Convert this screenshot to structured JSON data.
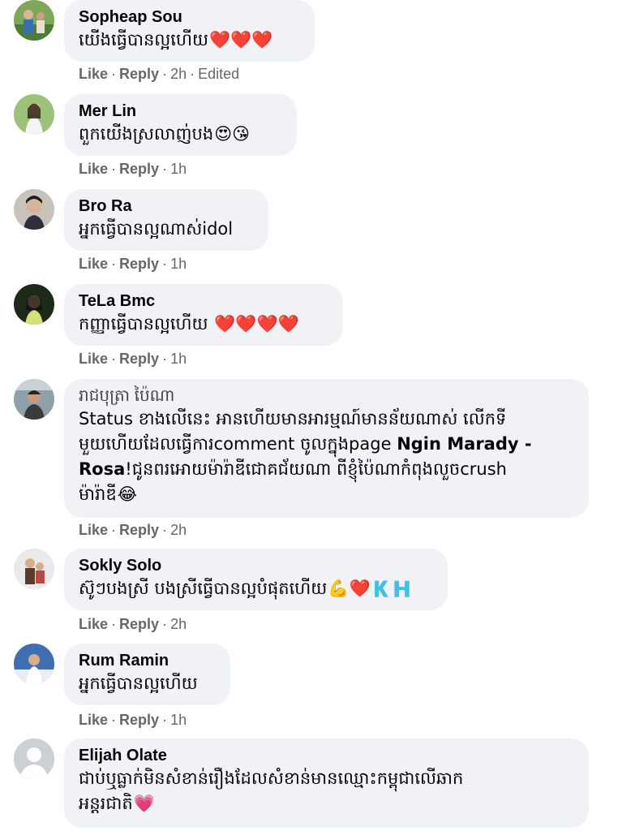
{
  "actions": {
    "like": "Like",
    "reply": "Reply",
    "separator": "·"
  },
  "comments": [
    {
      "name": "Sopheap Sou",
      "text": "យើងធ្វើបានល្អហើយ",
      "emoji": "❤️❤️❤️",
      "time": "2h",
      "edited": "Edited"
    },
    {
      "name": "Mer Lin",
      "text": "ពួកយើងស្រលាញ់បង",
      "emoji": "😍😘",
      "time": "1h"
    },
    {
      "name": "Bro Ra",
      "text": "អ្នកធ្វើបានល្អណាស់idol",
      "time": "1h"
    },
    {
      "name": "TeLa Bmc",
      "text": "កញ្ញាធ្វើបានល្អហើយ",
      "emoji": "❤️❤️❤️❤️",
      "time": "1h"
    },
    {
      "name": "រាជបុត្រា ប៉ៃណា",
      "line1": "Status ខាងលើនេះ អានហើយមានអារម្មណ៍មានន័យណាស់ លើកទី",
      "line2a": "មួយហើយដែលធ្វើការcomment ចូលក្នុងpage ",
      "line2b": "Ngin Marady -",
      "line3a": "Rosa",
      "line3b": "!ជូនពរអោយម៉ារ៉ាឌីជោគជ័យណា ពីខ្ញុំប៉ៃណាកំពុងលួចcrush",
      "line4": "ម៉ារ៉ាឌី",
      "emoji": "😂",
      "time": "2h"
    },
    {
      "name": "Sokly Solo",
      "text": "ស៊ូៗបងស្រី បងស្រីធ្វើបានល្អបំផុតហើយ",
      "emoji": "💪❤️🇰🇭",
      "time": "2h"
    },
    {
      "name": "Rum Ramin",
      "text": "អ្នកធ្វើបានល្អហើយ",
      "time": "1h"
    },
    {
      "name": "Elijah Olate",
      "line1": "ជាប់ឬធ្លាក់មិនសំខាន់រឿងដែលសំខាន់មានឈ្មោះកម្ពុជាលើឆាក",
      "line2": "អន្តរជាតិ",
      "emoji": "💗"
    }
  ]
}
